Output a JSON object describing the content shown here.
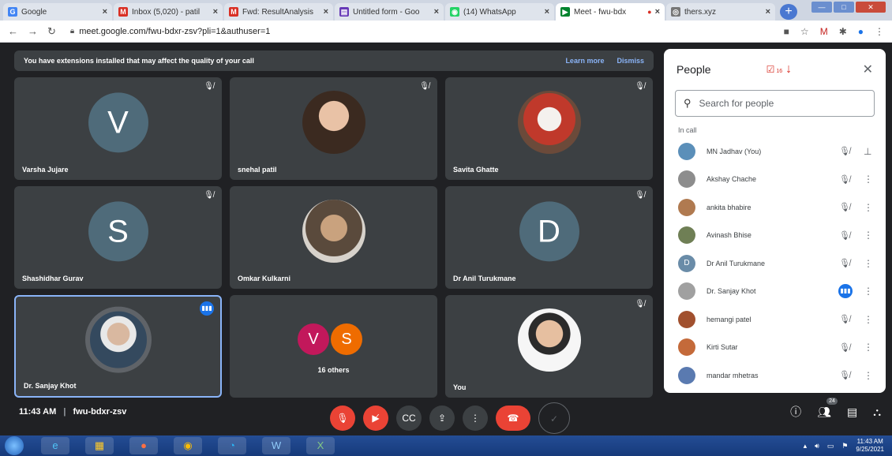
{
  "browser": {
    "tabs": [
      {
        "label": "Google",
        "icon": "G",
        "color": "#4285f4"
      },
      {
        "label": "Inbox (5,020) - patil",
        "icon": "M",
        "color": "#d93025"
      },
      {
        "label": "Fwd: ResultAnalysis",
        "icon": "M",
        "color": "#d93025"
      },
      {
        "label": "Untitled form - Goo",
        "icon": "▤",
        "color": "#673ab7"
      },
      {
        "label": "(14) WhatsApp",
        "icon": "◉",
        "color": "#25d366"
      },
      {
        "label": "Meet - fwu-bdx",
        "icon": "▶",
        "color": "#00832d"
      },
      {
        "label": "thers.xyz",
        "icon": "◎",
        "color": "#777777"
      }
    ],
    "url": "meet.google.com/fwu-bdxr-zsv?pli=1&authuser=1"
  },
  "banner": {
    "text": "You have extensions installed that may affect the quality of your call",
    "learn_more": "Learn more",
    "dismiss": "Dismiss"
  },
  "tiles": {
    "t1": {
      "name": "Varsha Jujare",
      "letter": "V"
    },
    "t2": {
      "name": "snehal patil"
    },
    "t3": {
      "name": "Savita Ghatte"
    },
    "t4": {
      "name": "Shashidhar Gurav",
      "letter": "S"
    },
    "t5": {
      "name": "Omkar Kulkarni"
    },
    "t6": {
      "name": "Dr Anil Turukmane",
      "letter": "D"
    },
    "t7": {
      "name": "Dr. Sanjay Khot"
    },
    "t8": {
      "name": "16 others",
      "a": "V",
      "b": "S"
    },
    "t9": {
      "name": "You"
    }
  },
  "meeting": {
    "time": "11:43 AM",
    "separator": "|",
    "code": "fwu-bdxr-zsv",
    "participant_count": "24"
  },
  "people": {
    "title": "People",
    "task_count": "16",
    "search_placeholder": "Search for people",
    "section": "In call",
    "rows": [
      {
        "name": "MN Jadhav (You)",
        "color": "#5b8fb9"
      },
      {
        "name": "Akshay Chache",
        "color": "#8d8d8d"
      },
      {
        "name": "ankita bhabire",
        "color": "#b07a50"
      },
      {
        "name": "Avinash Bhise",
        "color": "#6f7f55"
      },
      {
        "name": "Dr Anil Turukmane",
        "color": "#6a8ca8",
        "letter": "D"
      },
      {
        "name": "Dr. Sanjay Khot",
        "color": "#a0a0a0"
      },
      {
        "name": "hemangi patel",
        "color": "#a1502e"
      },
      {
        "name": "Kirti Sutar",
        "color": "#c46a3a"
      },
      {
        "name": "mandar mhetras",
        "color": "#5a7ab0"
      }
    ]
  },
  "taskbar": {
    "time": "11:43 AM",
    "date": "9/25/2021"
  }
}
